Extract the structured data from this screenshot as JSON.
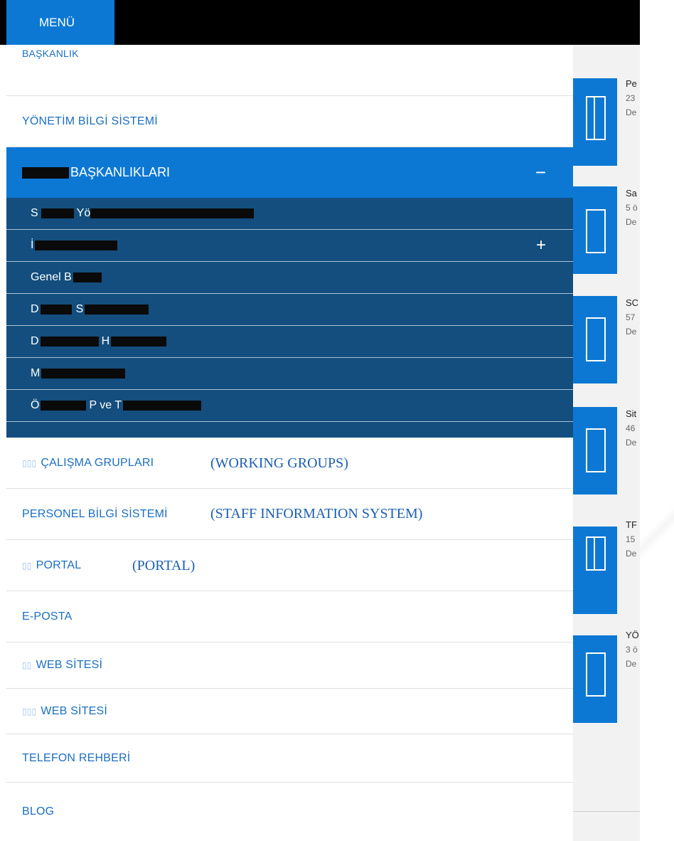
{
  "topbar": {
    "menu_label": "MENÜ"
  },
  "nav": {
    "partial_top": "BAŞKANLIK",
    "yonetim": "YÖNETİM BİLGİ SİSTEMİ",
    "active": {
      "label": "BAŞKANLIKLARI",
      "toggle": "−"
    },
    "sub_items": [
      {
        "label": "S",
        "tail": "Yö"
      },
      {
        "label": "İ",
        "tail": "",
        "toggle": "+"
      },
      {
        "label": "Genel B",
        "tail": ""
      },
      {
        "label": "D",
        "tail": "S"
      },
      {
        "label": "D",
        "tail": "H"
      },
      {
        "label": "M",
        "tail": ""
      },
      {
        "label": "Ö",
        "tail": "P ve T"
      }
    ],
    "calisma": "ÇALIŞMA GRUPLARI",
    "personel": "PERSONEL BİLGİ SİSTEMİ",
    "portal": "PORTAL",
    "eposta": "E-POSTA",
    "web1": "WEB SİTESİ",
    "web2": "WEB SİTESİ",
    "telefon": "TELEFON REHBERİ",
    "blog": "BLOG"
  },
  "annotations": {
    "working_groups": "(WORKING GROUPS)",
    "staff_info": "(STAFF INFORMATION SYSTEM)",
    "portal": "(PORTAL)"
  },
  "tiles": [
    {
      "t1": "Pe",
      "t2": "23",
      "t3": "De",
      "icon": "board-icon"
    },
    {
      "t1": "Sa",
      "t2": "5 ö",
      "t3": "De",
      "icon": "document-icon"
    },
    {
      "t1": "SC",
      "t2": "57",
      "t3": "De",
      "icon": "document-icon"
    },
    {
      "t1": "Sit",
      "t2": "46",
      "t3": "De",
      "icon": "document-icon"
    },
    {
      "t1": "TF",
      "t2": "15",
      "t3": "De",
      "icon": "board-icon"
    },
    {
      "t1": "YÖ",
      "t2": "3 ö",
      "t3": "De",
      "icon": "document-icon"
    }
  ],
  "colors": {
    "accent": "#0c78d4",
    "submenu_bg": "#134e7e",
    "link": "#1b6fc2",
    "topbar": "#000000"
  }
}
